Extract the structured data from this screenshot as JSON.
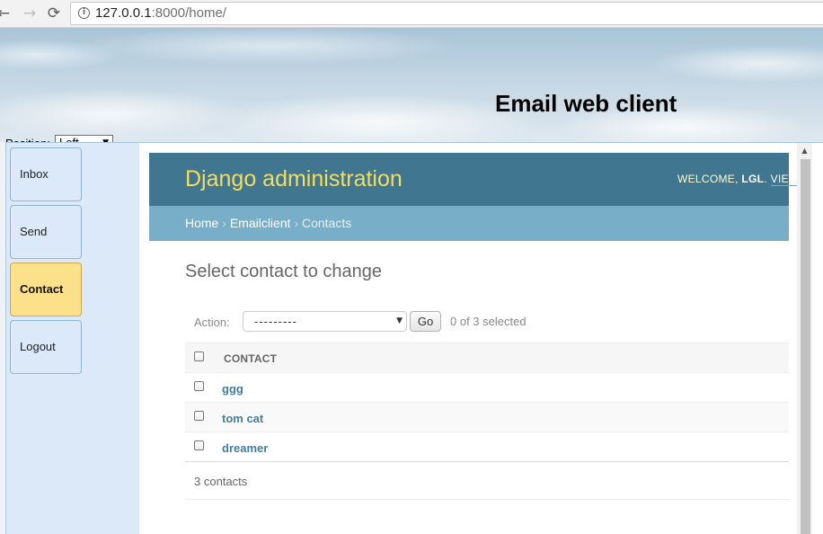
{
  "browser": {
    "nav_back": "←",
    "nav_forward": "→",
    "nav_reload": "⟳",
    "info_glyph": "i",
    "url_host": "127.0.0.1",
    "url_rest": ":8000/home/"
  },
  "header": {
    "title": "Email web client",
    "position_label": "Position:",
    "position_value": "Left"
  },
  "menu": {
    "items": [
      {
        "label": "Inbox"
      },
      {
        "label": "Send"
      },
      {
        "label": "Contact",
        "active": true
      },
      {
        "label": "Logout"
      }
    ]
  },
  "admin": {
    "brand": "Django administration",
    "welcome": "WELCOME, ",
    "username": "LGL",
    "after_username": ". ",
    "view_link": "VIEW",
    "breadcrumbs": {
      "home": "Home",
      "separator": " › ",
      "app": "Emailclient",
      "current": "Contacts"
    },
    "page_title": "Select contact to change",
    "actions": {
      "label": "Action:",
      "selected_option": "---------",
      "go_label": "Go",
      "selection_count": "0 of 3 selected"
    },
    "table": {
      "column_header": "CONTACT",
      "rows": [
        {
          "name": "ggg"
        },
        {
          "name": "tom cat"
        },
        {
          "name": "dreamer"
        }
      ]
    },
    "paginator": "3 contacts"
  },
  "colors": {
    "header_bg": "#417690",
    "brand_yellow": "#f5dd5d",
    "breadcrumb_bg": "#79aec8",
    "link_blue": "#447e9b",
    "menu_active": "#fde08a"
  }
}
